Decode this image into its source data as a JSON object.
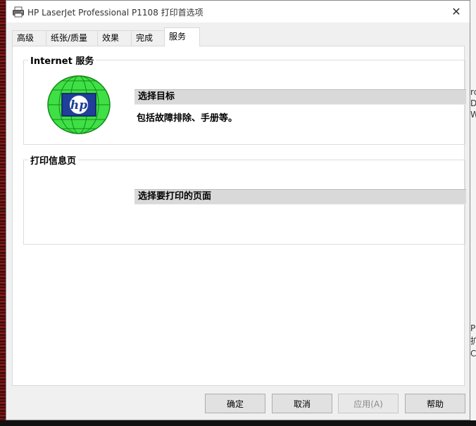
{
  "window": {
    "title": "HP LaserJet Professional P1108 打印首选项",
    "close_label": "✕"
  },
  "tabs": [
    {
      "label": "高级",
      "active": false
    },
    {
      "label": "纸张/质量",
      "active": false
    },
    {
      "label": "效果",
      "active": false
    },
    {
      "label": "完成",
      "active": false
    },
    {
      "label": "服务",
      "active": true
    }
  ],
  "internet_services": {
    "title": "Internet 服务",
    "link": "选择目标",
    "description": "包括故障排除、手册等。"
  },
  "print_info_pages": {
    "title": "打印信息页",
    "link": "选择要打印的页面"
  },
  "buttons": {
    "ok": "确定",
    "cancel": "取消",
    "apply": "应用(A)",
    "help": "帮助"
  },
  "background_peek": [
    "rc",
    "Dc",
    "W",
    "P",
    "扩",
    "C"
  ],
  "colors": {
    "globe_green": "#2fd13a",
    "hp_blue": "#1f3f9a",
    "link_bar": "#d9d9d9"
  }
}
